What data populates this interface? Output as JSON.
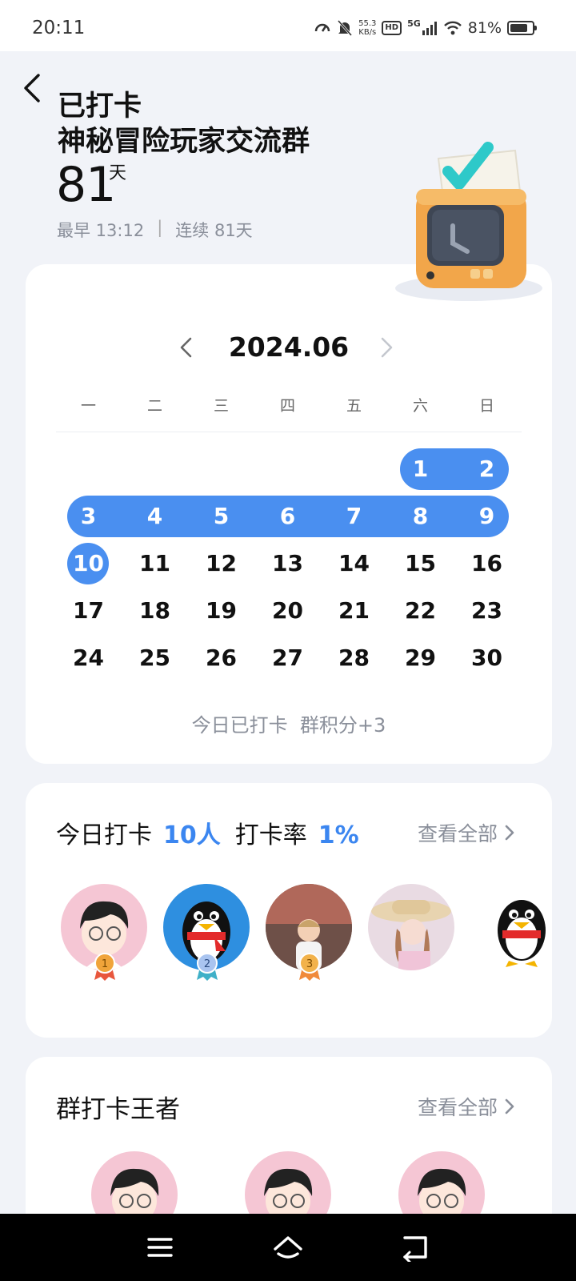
{
  "status_bar": {
    "time": "20:11",
    "net_speed_value": "55.3",
    "net_speed_unit": "KB/s",
    "hd": "HD",
    "network": "5G",
    "battery": "81%"
  },
  "header": {
    "status": "已打卡",
    "group_name": "神秘冒险玩家交流群",
    "days": "81",
    "days_unit": "天",
    "earliest": "最早 13:12",
    "separator": "|",
    "streak": "连续 81天"
  },
  "calendar": {
    "month": "2024.06",
    "weekdays": [
      "一",
      "二",
      "三",
      "四",
      "五",
      "六",
      "日"
    ],
    "weeks": [
      [
        "",
        "",
        "",
        "",
        "",
        "1",
        "2"
      ],
      [
        "3",
        "4",
        "5",
        "6",
        "7",
        "8",
        "9"
      ],
      [
        "10",
        "11",
        "12",
        "13",
        "14",
        "15",
        "16"
      ],
      [
        "17",
        "18",
        "19",
        "20",
        "21",
        "22",
        "23"
      ],
      [
        "24",
        "25",
        "26",
        "27",
        "28",
        "29",
        "30"
      ]
    ],
    "checked_days": [
      "1",
      "2",
      "3",
      "4",
      "5",
      "6",
      "7",
      "8",
      "9",
      "10"
    ],
    "today_note": "今日已打卡  群积分+3"
  },
  "today_checkin": {
    "label": "今日打卡",
    "count": "10人",
    "rate_label": "打卡率",
    "rate": "1%",
    "view_all": "查看全部",
    "ranks": [
      "1",
      "2",
      "3"
    ]
  },
  "group_king": {
    "title": "群打卡王者",
    "view_all": "查看全部"
  },
  "colors": {
    "accent": "#4a8ff0",
    "gold": "#f0a43a",
    "silver": "#8fb4e8",
    "bronze": "#e89a3a"
  }
}
